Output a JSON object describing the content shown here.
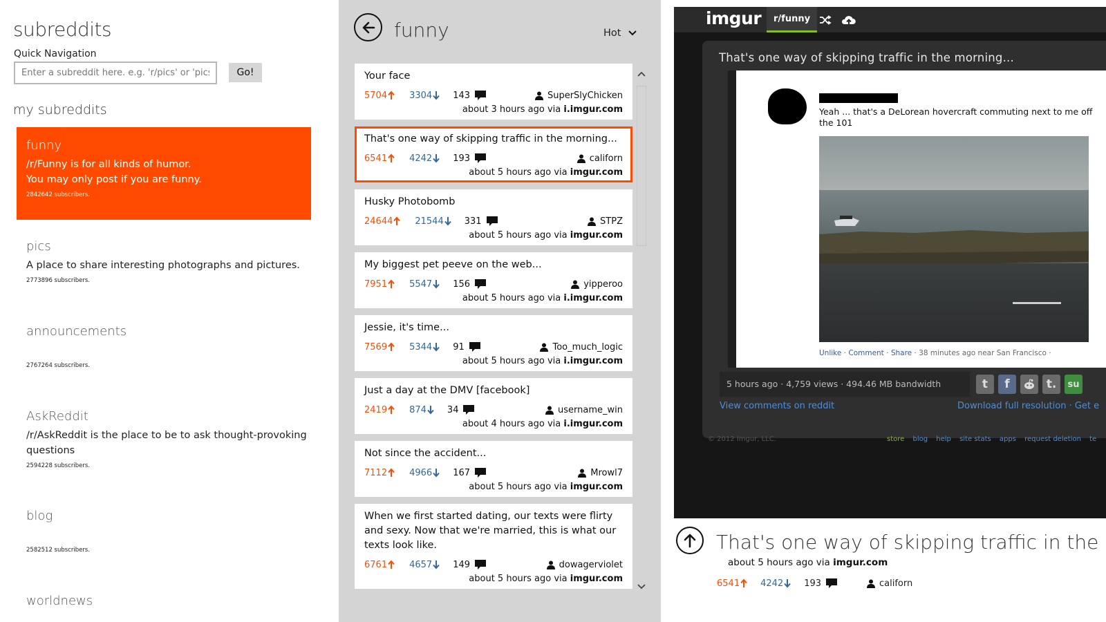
{
  "left": {
    "title": "subreddits",
    "quick_nav_label": "Quick Navigation",
    "quick_nav_placeholder": "Enter a subreddit here. e.g. 'r/pics' or 'pics'",
    "go_label": "Go!",
    "my_subreddits_label": "my subreddits",
    "subreddits": [
      {
        "name": "funny",
        "description": "/r/Funny is for all kinds of humor. You may only post if you are funny.",
        "subscribers": "2842642 subscribers."
      },
      {
        "name": "pics",
        "description": "A place to share interesting photographs and pictures.",
        "subscribers": "2773896 subscribers."
      },
      {
        "name": "announcements",
        "description": "",
        "subscribers": "2767264 subscribers."
      },
      {
        "name": "AskReddit",
        "description": "/r/AskReddit is the place to be to ask thought-provoking questions",
        "subscribers": "2594228 subscribers."
      },
      {
        "name": "blog",
        "description": "",
        "subscribers": "2582512 subscribers."
      },
      {
        "name": "worldnews",
        "description": "",
        "subscribers": ""
      }
    ]
  },
  "middle": {
    "subreddit_title": "funny",
    "sort_label": "Hot",
    "posts": [
      {
        "title": "Your face",
        "ups": "5704",
        "downs": "3304",
        "comments": "143",
        "author": "SuperSlyChicken",
        "time": "about 3 hours ago",
        "via_label": "via",
        "domain": "i.imgur.com"
      },
      {
        "title": "That's one way of skipping traffic in the morning...",
        "ups": "6541",
        "downs": "4242",
        "comments": "193",
        "author": "californ",
        "time": "about 5 hours ago",
        "via_label": "via",
        "domain": "imgur.com"
      },
      {
        "title": "Husky Photobomb",
        "ups": "24644",
        "downs": "21544",
        "comments": "331",
        "author": "STPZ",
        "time": "about 5 hours ago",
        "via_label": "via",
        "domain": "imgur.com"
      },
      {
        "title": "My biggest pet peeve on the web...",
        "ups": "7951",
        "downs": "5547",
        "comments": "156",
        "author": "yipperoo",
        "time": "about 5 hours ago",
        "via_label": "via",
        "domain": "i.imgur.com"
      },
      {
        "title": "Jessie, it's time...",
        "ups": "7569",
        "downs": "5344",
        "comments": "91",
        "author": "Too_much_logic",
        "time": "about 5 hours ago",
        "via_label": "via",
        "domain": "i.imgur.com"
      },
      {
        "title": "Just a day at the DMV [facebook]",
        "ups": "2419",
        "downs": "874",
        "comments": "34",
        "author": "username_win",
        "time": "about 4 hours ago",
        "via_label": "via",
        "domain": "i.imgur.com"
      },
      {
        "title": "Not since the accident...",
        "ups": "7112",
        "downs": "4966",
        "comments": "167",
        "author": "Mrowl7",
        "time": "about 5 hours ago",
        "via_label": "via",
        "domain": "imgur.com"
      },
      {
        "title": "When we first started dating, our texts were flirty and sexy. Now that we're married, this is what our texts look like.",
        "ups": "6761",
        "downs": "4657",
        "comments": "149",
        "author": "dowagerviolet",
        "time": "about 5 hours ago",
        "via_label": "via",
        "domain": "imgur.com"
      }
    ]
  },
  "imgur": {
    "logo": "imgur",
    "nav_tab": "r/funny",
    "post_title": "That's one way of skipping traffic in the morning...",
    "fb_post_text": "Yeah ... that's a DeLorean hovercraft commuting next to me off the 101",
    "fb_unlike": "Unlike",
    "fb_comment": "Comment",
    "fb_share": "Share",
    "fb_time": "38 minutes ago near San Francisco",
    "stats": "5 hours ago · 4,759 views · 494.46 MB bandwidth",
    "view_comments": "View comments on reddit",
    "download": "Download full resolution · Get e",
    "copyright": "© 2012 Imgur, LLC.",
    "footer_links": [
      "store",
      "blog",
      "help",
      "site stats",
      "apps",
      "request deletion",
      "te"
    ]
  },
  "detail": {
    "title": "That's one way of skipping traffic in the morning...",
    "time": "about 5 hours ago",
    "via_label": "via",
    "domain": "imgur.com",
    "ups": "6541",
    "downs": "4242",
    "comments": "193",
    "author": "californ"
  },
  "colors": {
    "accent": "#ff4a00",
    "downvote": "#336699",
    "imgur_green": "#85bf25"
  }
}
